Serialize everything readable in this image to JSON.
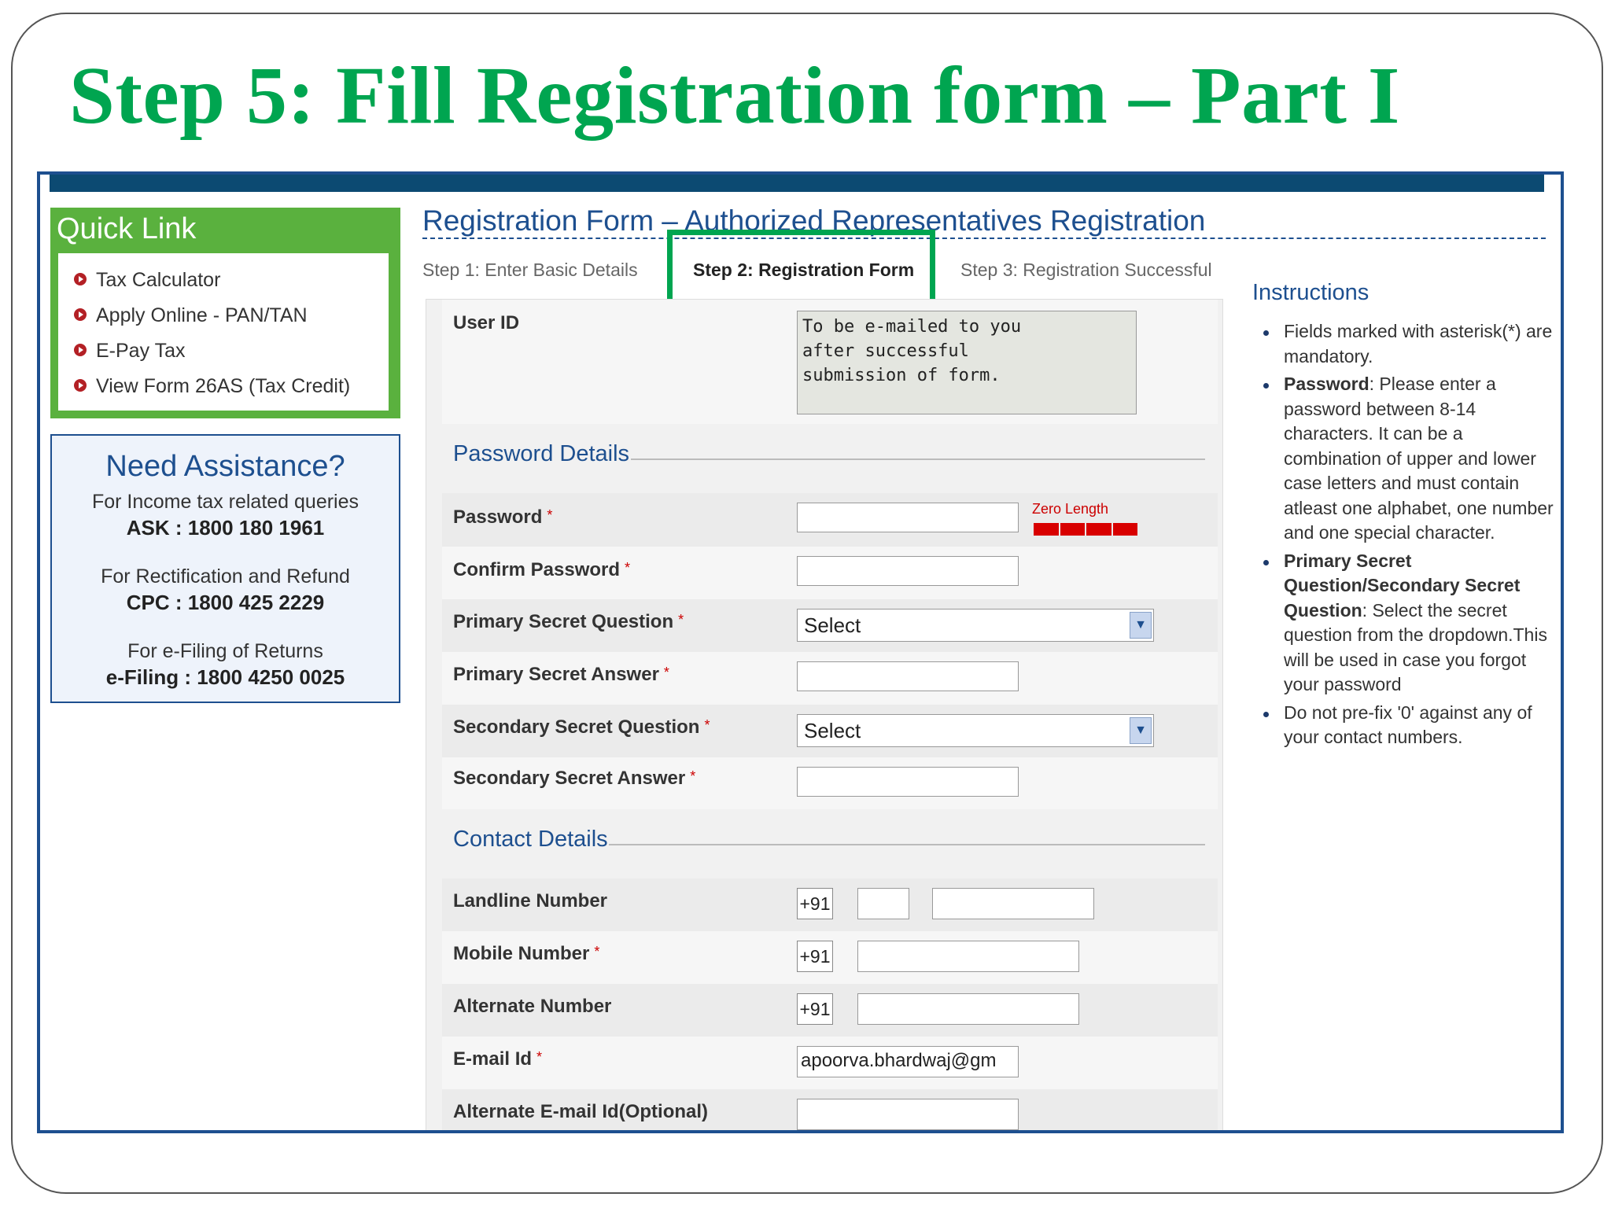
{
  "slide_title": "Step 5: Fill Registration form – Part I",
  "quick_link": {
    "title": "Quick Link",
    "items": [
      "Tax Calculator",
      "Apply Online - PAN/TAN",
      "E-Pay Tax",
      "View Form 26AS (Tax Credit)"
    ]
  },
  "assistance": {
    "title": "Need Assistance?",
    "line1": "For Income tax related queries",
    "line1_bold": "ASK : 1800 180 1961",
    "line2": "For Rectification and Refund",
    "line2_bold": "CPC : 1800 425 2229",
    "line3": "For e-Filing of Returns",
    "line3_bold": "e-Filing : 1800 4250 0025"
  },
  "header": {
    "title": "Registration Form – Authorized Representatives Registration",
    "step1": "Step 1: Enter Basic Details",
    "step2": "Step 2: Registration Form",
    "step3": "Step 3: Registration Successful"
  },
  "form": {
    "user_id_label": "User ID",
    "user_id_line1": "To be e-mailed to you",
    "user_id_line2": "after successful",
    "user_id_line3": "submission of form.",
    "password_section": "Password Details",
    "password_label": "Password",
    "strength_text": "Zero Length",
    "confirm_label": "Confirm Password",
    "pq_label": "Primary Secret Question",
    "pq_value": "Select",
    "pa_label": "Primary Secret Answer",
    "sq_label": "Secondary Secret Question",
    "sq_value": "Select",
    "sa_label": "Secondary Secret Answer",
    "contact_section": "Contact Details",
    "landline_label": "Landline Number",
    "mobile_label": "Mobile Number",
    "alternate_label": "Alternate Number",
    "country_code": "+91",
    "email_label": "E-mail Id",
    "email_value": "apoorva.bhardwaj@gm",
    "alt_email_label": "Alternate E-mail Id(Optional)",
    "required_mark": "*"
  },
  "instructions": {
    "title": "Instructions",
    "item1": "Fields marked with asterisk(*) are mandatory.",
    "item2_bold": "Password",
    "item2": ": Please enter a password between 8-14 characters. It can be a combination of upper and lower case letters and must contain atleast one alphabet, one number and one special character.",
    "item3_bold": "Primary Secret Question/Secondary Secret Question",
    "item3": ": Select the secret question from the dropdown.This will be used in case you forgot your password",
    "item4": "Do not pre-fix '0' against any of your contact numbers."
  },
  "colors": {
    "title_green": "#00a550",
    "nav_blue": "#1d4f8f",
    "quick_green": "#5ab13e",
    "strength_red": "#d80000"
  }
}
